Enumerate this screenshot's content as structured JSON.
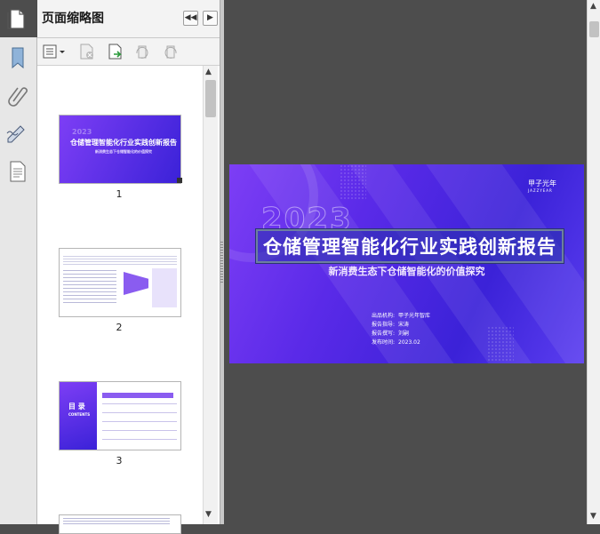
{
  "panel": {
    "title": "页面缩略图"
  },
  "pages": [
    {
      "number": "1",
      "mini_title": "仓储管理智能化行业实践创新报告",
      "mini_subtitle": "新消费生态下仓储智能化的价值探究",
      "mini_year": "2023"
    },
    {
      "number": "2"
    },
    {
      "number": "3",
      "mini_label": "目 录",
      "mini_sub": "CONTENTS"
    }
  ],
  "slide": {
    "year": "2023",
    "title": "仓储管理智能化行业实践创新报告",
    "subtitle": "新消费生态下仓储智能化的价值探究",
    "logo": "甲子光年",
    "logo_sub": "JAZZYEAR",
    "meta": [
      {
        "key": "出品机构:",
        "value": "甲子光年智库"
      },
      {
        "key": "报告指导:",
        "value": "宋涛"
      },
      {
        "key": "报告撰写:",
        "value": "刘嗣"
      },
      {
        "key": "发布时间:",
        "value": "2023.02"
      }
    ]
  },
  "icons": {
    "strip": [
      "bookmark-icon",
      "attachment-icon",
      "signature-icon",
      "page-icon"
    ],
    "toolbar": [
      "options-icon",
      "delete-page-icon",
      "insert-page-icon",
      "rotate-ccw-icon",
      "rotate-cw-icon"
    ]
  },
  "colors": {
    "slide_accent": "#5a2ae8",
    "viewer_bg": "#4d4d4d"
  }
}
